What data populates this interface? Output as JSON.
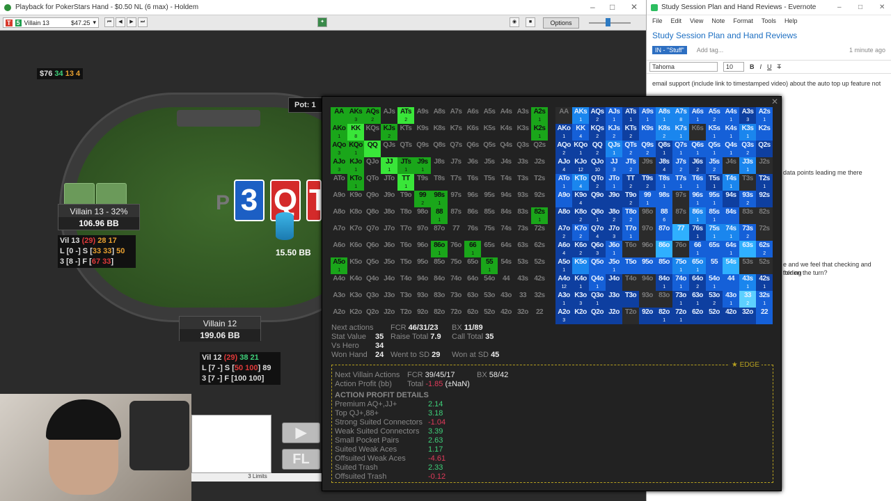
{
  "poker": {
    "title": "Playback for PokerStars Hand - $0.50 NL (6 max) - Holdem",
    "player_select": "Villain 13",
    "player_amount": "$47.25",
    "options_label": "Options",
    "stack_badge": {
      "amount": "$76",
      "n1": "34",
      "n2": "13",
      "n3": "4"
    },
    "pot_label": "Pot: 1",
    "board_cards": [
      "3",
      "Q",
      "T"
    ],
    "board_partial": "P",
    "chip_amount": "15.50 BB",
    "seat1": {
      "name": "Villain 13 - 32%",
      "stack": "106.96 BB"
    },
    "seat2": {
      "name": "Villain 12",
      "stack": "199.06 BB"
    },
    "hud1": {
      "l1a": "Vil 13 ",
      "l1b": "(29)",
      "l1c": " 28 ",
      "l1d": "17",
      "l2a": "L [0 -] S [",
      "l2b": "33 33",
      "l2c": "] ",
      "l2d": "50",
      "l3a": "3 [8 -] F [",
      "l3b": "67 33",
      "l3c": "]"
    },
    "hud2": {
      "l1a": "Vil 12 ",
      "l1b": "(29)",
      "l1c": " 38 ",
      "l1d": "21",
      "l2a": "L [7 -] S [",
      "l2b": "50 100",
      "l2c": "] 89",
      "l3a": "3 [7 -] F [100 100]"
    },
    "limits": "3 Limits",
    "btn_fold": "FL"
  },
  "evernote": {
    "window_title": "Study Session Plan and Hand Reviews - Evernote",
    "menu": [
      "File",
      "Edit",
      "View",
      "Note",
      "Format",
      "Tools",
      "Help"
    ],
    "note_title": "Study Session Plan and Hand Reviews",
    "notebook": "IN - \"Stuff\"",
    "add_tag": "Add tag...",
    "updated": "1 minute ago",
    "font": "Tahoma",
    "size": "10",
    "body1": "email support (include link to timestamped video) about the auto top up feature not",
    "body2": "data points leading me there",
    "body3": "e and we feel that checking and folding",
    "body4": "tter on the turn?"
  },
  "overlay": {
    "stats": {
      "next_actions_label": "Next actions",
      "fcr_label": "FCR",
      "fcr": "46/31/23",
      "bx_label": "BX",
      "bx": "11/89",
      "stat_value_label": "Stat Value",
      "stat_value": "35",
      "raise_total_label": "Raise Total",
      "raise_total": "7.9",
      "call_total_label": "Call Total",
      "call_total": "35",
      "vs_hero_label": "Vs Hero",
      "vs_hero": "34",
      "won_hand_label": "Won Hand",
      "won_hand": "24",
      "went_sd_label": "Went to SD",
      "went_sd": "29",
      "won_sd_label": "Won at SD",
      "won_sd": "45"
    },
    "edge": {
      "tag": "★ EDGE",
      "nva_label": "Next Villain Actions",
      "fcr_label": "FCR",
      "fcr": "39/45/17",
      "bx_label": "BX",
      "bx": "58/42",
      "ap_label": "Action Profit (bb)",
      "total_label": "Total",
      "total": "-1.85",
      "total_nan": "(±NaN)",
      "details_title": "ACTION PROFIT DETAILS",
      "rows": [
        {
          "label": "Premium AQ+,JJ+",
          "value": "2.14",
          "color": "#3fd07a"
        },
        {
          "label": "Top QJ+,88+",
          "value": "3.18",
          "color": "#3fd07a"
        },
        {
          "label": "Strong Suited Connectors",
          "value": "-1.04",
          "color": "#e03a5a"
        },
        {
          "label": "Weak Suited Connectors",
          "value": "3.39",
          "color": "#3fd07a"
        },
        {
          "label": "Small Pocket Pairs",
          "value": "2.63",
          "color": "#3fd07a"
        },
        {
          "label": "Suited Weak Aces",
          "value": "1.17",
          "color": "#3fd07a"
        },
        {
          "label": "Offsuited Weak Aces",
          "value": "-4.61",
          "color": "#e03a5a"
        },
        {
          "label": "Suited Trash",
          "value": "2.33",
          "color": "#3fd07a"
        },
        {
          "label": "Offsuited Trash",
          "value": "-0.12",
          "color": "#e03a5a"
        }
      ]
    },
    "hands": [
      [
        "AA",
        "AKs",
        "AQs",
        "AJs",
        "ATs",
        "A9s",
        "A8s",
        "A7s",
        "A6s",
        "A5s",
        "A4s",
        "A3s",
        "A2s"
      ],
      [
        "AKo",
        "KK",
        "KQs",
        "KJs",
        "KTs",
        "K9s",
        "K8s",
        "K7s",
        "K6s",
        "K5s",
        "K4s",
        "K3s",
        "K2s"
      ],
      [
        "AQo",
        "KQo",
        "QQ",
        "QJs",
        "QTs",
        "Q9s",
        "Q8s",
        "Q7s",
        "Q6s",
        "Q5s",
        "Q4s",
        "Q3s",
        "Q2s"
      ],
      [
        "AJo",
        "KJo",
        "QJo",
        "JJ",
        "JTs",
        "J9s",
        "J8s",
        "J7s",
        "J6s",
        "J5s",
        "J4s",
        "J3s",
        "J2s"
      ],
      [
        "ATo",
        "KTo",
        "QTo",
        "JTo",
        "TT",
        "T9s",
        "T8s",
        "T7s",
        "T6s",
        "T5s",
        "T4s",
        "T3s",
        "T2s"
      ],
      [
        "A9o",
        "K9o",
        "Q9o",
        "J9o",
        "T9o",
        "99",
        "98s",
        "97s",
        "96s",
        "95s",
        "94s",
        "93s",
        "92s"
      ],
      [
        "A8o",
        "K8o",
        "Q8o",
        "J8o",
        "T8o",
        "98o",
        "88",
        "87s",
        "86s",
        "85s",
        "84s",
        "83s",
        "82s"
      ],
      [
        "A7o",
        "K7o",
        "Q7o",
        "J7o",
        "T7o",
        "97o",
        "87o",
        "77",
        "76s",
        "75s",
        "74s",
        "73s",
        "72s"
      ],
      [
        "A6o",
        "K6o",
        "Q6o",
        "J6o",
        "T6o",
        "96o",
        "86o",
        "76o",
        "66",
        "65s",
        "64s",
        "63s",
        "62s"
      ],
      [
        "A5o",
        "K5o",
        "Q5o",
        "J5o",
        "T5o",
        "95o",
        "85o",
        "75o",
        "65o",
        "55",
        "54s",
        "53s",
        "52s"
      ],
      [
        "A4o",
        "K4o",
        "Q4o",
        "J4o",
        "T4o",
        "94o",
        "84o",
        "74o",
        "64o",
        "54o",
        "44",
        "43s",
        "42s"
      ],
      [
        "A3o",
        "K3o",
        "Q3o",
        "J3o",
        "T3o",
        "93o",
        "83o",
        "73o",
        "63o",
        "53o",
        "43o",
        "33",
        "32s"
      ],
      [
        "A2o",
        "K2o",
        "Q2o",
        "J2o",
        "T2o",
        "92o",
        "82o",
        "72o",
        "62o",
        "52o",
        "42o",
        "32o",
        "22"
      ]
    ],
    "left_green": {
      "0,0": [
        2,
        ""
      ],
      "0,1": [
        2,
        "3"
      ],
      "0,2": [
        2,
        "2"
      ],
      "0,4": [
        1,
        "2"
      ],
      "0,12": [
        2,
        "1"
      ],
      "1,0": [
        2,
        "1"
      ],
      "1,1": [
        1,
        "8"
      ],
      "1,3": [
        2,
        "2"
      ],
      "1,12": [
        2,
        "1"
      ],
      "2,0": [
        2,
        "3"
      ],
      "2,1": [
        2,
        "1"
      ],
      "2,2": [
        1,
        ""
      ],
      "3,0": [
        2,
        "3"
      ],
      "3,1": [
        2,
        "1"
      ],
      "3,3": [
        1,
        "1"
      ],
      "3,4": [
        2,
        "1"
      ],
      "3,5": [
        2,
        "1"
      ],
      "4,1": [
        2,
        "1"
      ],
      "4,4": [
        1,
        "1"
      ],
      "5,5": [
        2,
        "2"
      ],
      "5,6": [
        2,
        "1"
      ],
      "6,6": [
        2,
        "1"
      ],
      "6,12": [
        2,
        "1"
      ],
      "8,6": [
        2,
        "1"
      ],
      "8,8": [
        2,
        "1"
      ],
      "9,0": [
        2,
        "1"
      ],
      "9,9": [
        2,
        "1"
      ]
    },
    "right_blue": {
      "0": [
        [
          "",
          0
        ],
        [
          "1",
          3
        ],
        [
          "2",
          1
        ],
        [
          "1",
          2
        ],
        [
          "1",
          1
        ],
        [
          "1",
          2
        ],
        [
          "1",
          3
        ],
        [
          "8",
          3
        ],
        [
          "1",
          2
        ],
        [
          "2",
          2
        ],
        [
          "1",
          2
        ],
        [
          "3",
          1
        ],
        [
          "1",
          2
        ]
      ],
      "1": [
        [
          "1",
          1
        ],
        [
          "4",
          2
        ],
        [
          "2",
          1
        ],
        [
          "2",
          2
        ],
        [
          "2",
          1
        ],
        [
          "",
          2
        ],
        [
          "2",
          3
        ],
        [
          "1",
          3
        ],
        [
          "",
          0
        ],
        [
          "1",
          2
        ],
        [
          "1",
          2
        ],
        [
          "1",
          3
        ],
        [
          "",
          2
        ]
      ],
      "2": [
        [
          "2",
          1
        ],
        [
          "1",
          1
        ],
        [
          "2",
          1
        ],
        [
          "1",
          3
        ],
        [
          "2",
          2
        ],
        [
          "2",
          2
        ],
        [
          "1",
          1
        ],
        [
          "1",
          2
        ],
        [
          "1",
          2
        ],
        [
          "1",
          2
        ],
        [
          "1",
          2
        ],
        [
          "2",
          2
        ],
        [
          "",
          1
        ]
      ],
      "3": [
        [
          "4",
          1
        ],
        [
          "12",
          1
        ],
        [
          "10",
          1
        ],
        [
          "3",
          2
        ],
        [
          "2",
          2
        ],
        [
          "",
          0
        ],
        [
          "4",
          1
        ],
        [
          "2",
          2
        ],
        [
          "2",
          1
        ],
        [
          "2",
          2
        ],
        [
          "",
          0
        ],
        [
          "1",
          3
        ],
        [
          "",
          0
        ]
      ],
      "4": [
        [
          "1",
          2
        ],
        [
          "4",
          3
        ],
        [
          "2",
          1
        ],
        [
          "1",
          2
        ],
        [
          "2",
          1
        ],
        [
          "2",
          1
        ],
        [
          "1",
          2
        ],
        [
          "1",
          2
        ],
        [
          "1",
          2
        ],
        [
          "1",
          1
        ],
        [
          "1",
          3
        ],
        [
          "",
          0
        ],
        [
          "1",
          1
        ]
      ],
      "5": [
        [
          "",
          2
        ],
        [
          "4",
          1
        ],
        [
          "",
          1
        ],
        [
          "",
          1
        ],
        [
          "2",
          1
        ],
        [
          "1",
          2
        ],
        [
          "",
          2
        ],
        [
          "",
          0
        ],
        [
          "1",
          2
        ],
        [
          "1",
          2
        ],
        [
          "",
          1
        ],
        [
          "2",
          2
        ],
        [
          "",
          1
        ]
      ],
      "6": [
        [
          "",
          1
        ],
        [
          "2",
          1
        ],
        [
          "1",
          1
        ],
        [
          "2",
          1
        ],
        [
          "2",
          2
        ],
        [
          "",
          0
        ],
        [
          "6",
          2
        ],
        [
          "",
          0
        ],
        [
          "1",
          3
        ],
        [
          "1",
          2
        ],
        [
          "",
          2
        ],
        [
          "",
          0
        ],
        [
          "",
          0
        ]
      ],
      "7": [
        [
          "2",
          1
        ],
        [
          "2",
          2
        ],
        [
          "4",
          1
        ],
        [
          "3",
          1
        ],
        [
          "1",
          2
        ],
        [
          "",
          0
        ],
        [
          "",
          2
        ],
        [
          "",
          4
        ],
        [
          "1",
          1
        ],
        [
          "1",
          3
        ],
        [
          "1",
          3
        ],
        [
          "2",
          2
        ],
        [
          "",
          0
        ]
      ],
      "8": [
        [
          "4",
          1
        ],
        [
          "2",
          1
        ],
        [
          "3",
          1
        ],
        [
          "1",
          2
        ],
        [
          "",
          0
        ],
        [
          "",
          0
        ],
        [
          "",
          4
        ],
        [
          "",
          0
        ],
        [
          "1",
          2
        ],
        [
          "",
          2
        ],
        [
          "1",
          2
        ],
        [
          "",
          4
        ],
        [
          "2",
          2
        ]
      ],
      "9": [
        [
          "1",
          1
        ],
        [
          "",
          3
        ],
        [
          "",
          2
        ],
        [
          "1",
          2
        ],
        [
          "",
          2
        ],
        [
          "",
          2
        ],
        [
          "",
          2
        ],
        [
          "1",
          3
        ],
        [
          "1",
          3
        ],
        [
          "",
          2
        ],
        [
          "",
          4
        ],
        [
          "",
          0
        ],
        [
          "",
          0
        ]
      ],
      "10": [
        [
          "12",
          1
        ],
        [
          "1",
          1
        ],
        [
          "1",
          2
        ],
        [
          "",
          1
        ],
        [
          "",
          0
        ],
        [
          "",
          0
        ],
        [
          "1",
          1
        ],
        [
          "1",
          2
        ],
        [
          "2",
          1
        ],
        [
          "1",
          2
        ],
        [
          "",
          2
        ],
        [
          "1",
          3
        ],
        [
          "1",
          1
        ]
      ],
      "11": [
        [
          "1",
          1
        ],
        [
          "3",
          1
        ],
        [
          "1",
          1
        ],
        [
          "",
          1
        ],
        [
          "",
          1
        ],
        [
          "",
          0
        ],
        [
          "",
          0
        ],
        [
          "1",
          1
        ],
        [
          "1",
          1
        ],
        [
          "2",
          1
        ],
        [
          "1",
          2
        ],
        [
          "2",
          5
        ],
        [
          "1",
          2
        ]
      ],
      "12": [
        [
          "3",
          1
        ],
        [
          "",
          1
        ],
        [
          "",
          1
        ],
        [
          "",
          1
        ],
        [
          "",
          0
        ],
        [
          "",
          1
        ],
        [
          "1",
          1
        ],
        [
          "1",
          1
        ],
        [
          "",
          1
        ],
        [
          "",
          1
        ],
        [
          "",
          1
        ],
        [
          "",
          1
        ],
        [
          "",
          2
        ]
      ]
    }
  }
}
